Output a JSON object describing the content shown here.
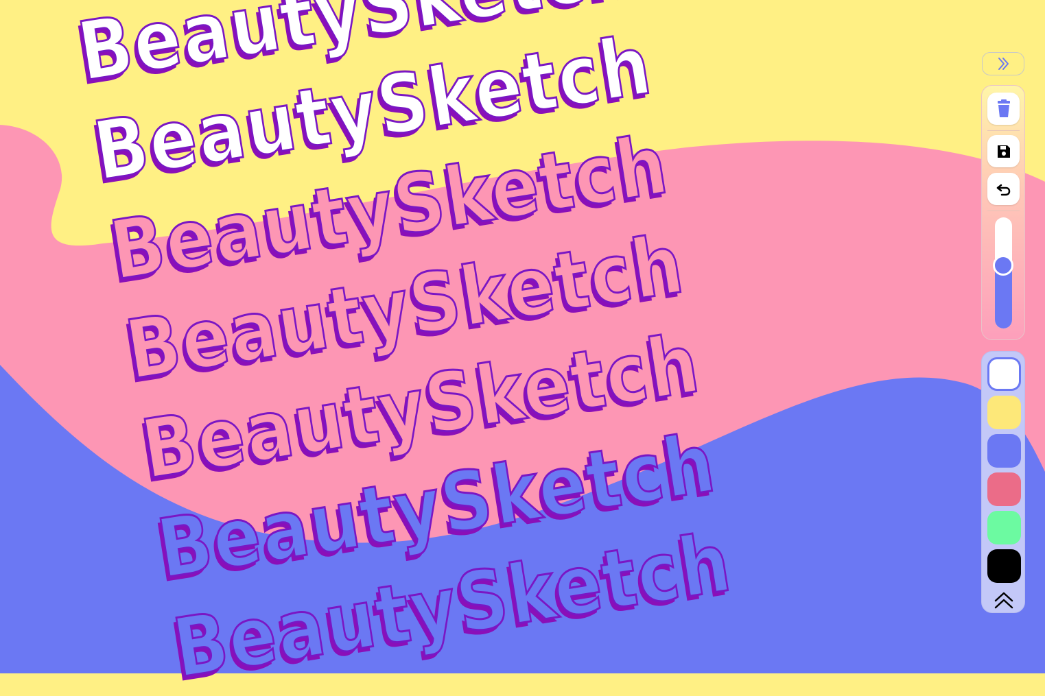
{
  "brand": {
    "rows": [
      "BeautySketch",
      "BeautySketch",
      "BeautySketch",
      "BeautySketch",
      "BeautySketch",
      "BeautySketch",
      "BeautySketch"
    ]
  },
  "canvas": {
    "colors": {
      "yellow": "#fff084",
      "pink": "#fd96b4",
      "blue": "#6b78f3",
      "outline": "#7a16c4"
    }
  },
  "toolbar": {
    "collapse_icon": "double-chevron-right-icon",
    "tools": [
      {
        "name": "delete",
        "icon": "trash-icon"
      },
      {
        "name": "save",
        "icon": "floppy-disk-icon"
      },
      {
        "name": "undo",
        "icon": "undo-icon"
      }
    ],
    "brush_size": {
      "level": 0.57,
      "accent": "#6b78f3"
    }
  },
  "palette": {
    "selected_index": 0,
    "swatches": [
      {
        "name": "white",
        "color": "#ffffff"
      },
      {
        "name": "yellow",
        "color": "#fde879"
      },
      {
        "name": "blue",
        "color": "#6b78f3"
      },
      {
        "name": "red",
        "color": "#eb6c88"
      },
      {
        "name": "green",
        "color": "#6cfaa1"
      },
      {
        "name": "black",
        "color": "#000000"
      }
    ],
    "expand_icon": "double-chevron-up-icon"
  }
}
